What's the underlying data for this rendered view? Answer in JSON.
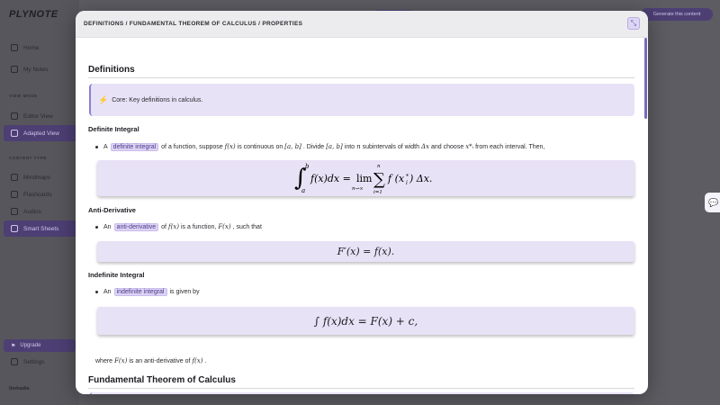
{
  "app": {
    "logo": "PLYNOTE",
    "top_button": "Generate this content"
  },
  "sidebar": {
    "items": [
      {
        "label": "Home",
        "icon": "home-icon"
      },
      {
        "label": "My Notes",
        "icon": "notes-icon"
      }
    ],
    "view_mode_heading": "VIEW MODE",
    "view_items": [
      {
        "label": "Editor View",
        "icon": "editor-icon"
      },
      {
        "label": "Adapted View",
        "icon": "adapted-icon",
        "active": true
      }
    ],
    "content_type_heading": "CONTENT TYPE",
    "content_items": [
      {
        "label": "Mindmaps",
        "icon": "mindmap-icon"
      },
      {
        "label": "Flashcards",
        "icon": "flashcard-icon"
      },
      {
        "label": "Audios",
        "icon": "audio-icon"
      },
      {
        "label": "Smart Sheets",
        "icon": "sheet-icon",
        "active": true
      }
    ],
    "upgrade": "Upgrade",
    "settings": "Settings",
    "user": "Ibnhadia"
  },
  "modal": {
    "breadcrumb": "DEFINITIONS / FUNDAMENTAL THEOREM OF CALCULUS / PROPERTIES",
    "sections": {
      "definitions_title": "Definitions",
      "callout_text": "Core: Key definitions in calculus.",
      "definite_integral": {
        "title": "Definite Integral",
        "pre": "A",
        "term": "definite integral",
        "text1": "of a function, suppose",
        "m1": "f(x)",
        "text2": "is continuous on",
        "m2": "[a, b]",
        "text3": ". Divide",
        "m3": "[a, b]",
        "text4": "into",
        "m4": "n",
        "text5": "subintervals of width",
        "m5": "Δx",
        "text6": "and choose",
        "m6": "x*ᵢ",
        "text7": "from each interval. Then,"
      },
      "anti_derivative": {
        "title": "Anti-Derivative",
        "pre": "An",
        "term": "anti-derivative",
        "text1": "of",
        "m1": "f(x)",
        "text2": "is a function,",
        "m2": "F(x)",
        "text3": ", such that",
        "equation": "F′(x) = f(x)."
      },
      "indefinite_integral": {
        "title": "Indefinite Integral",
        "pre": "An",
        "term": "indefinite integral",
        "text1": "is given by",
        "equation": "∫ f(x)dx = F(x) + c,",
        "after_pre": "where",
        "after_m1": "F(x)",
        "after_text": "is an anti-derivative of",
        "after_m2": "f(x)",
        "after_end": "."
      },
      "ftc_title": "Fundamental Theorem of Calculus"
    }
  },
  "colors": {
    "accent": "#8f7ed3",
    "highlight_bg": "#ddd3f4",
    "mathbox_bg": "#e8e2f6"
  }
}
